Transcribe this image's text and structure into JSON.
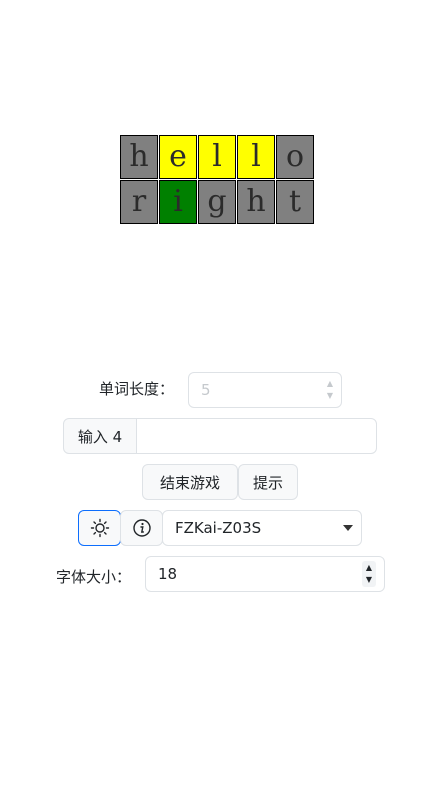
{
  "board": {
    "rows": [
      [
        {
          "letter": "h",
          "state": "gray"
        },
        {
          "letter": "e",
          "state": "yellow"
        },
        {
          "letter": "l",
          "state": "yellow"
        },
        {
          "letter": "l",
          "state": "yellow"
        },
        {
          "letter": "o",
          "state": "gray"
        }
      ],
      [
        {
          "letter": "r",
          "state": "gray"
        },
        {
          "letter": "i",
          "state": "green"
        },
        {
          "letter": "g",
          "state": "gray"
        },
        {
          "letter": "h",
          "state": "gray"
        },
        {
          "letter": "t",
          "state": "gray"
        }
      ]
    ],
    "colors": {
      "gray": "#808080",
      "yellow": "#ffff00",
      "green": "#008000"
    }
  },
  "word_length": {
    "label": "单词长度：",
    "value": "5"
  },
  "guess": {
    "button_label": "输入 4",
    "value": ""
  },
  "actions": {
    "end_game": "结束游戏",
    "hint": "提示"
  },
  "toolbar": {
    "theme_icon": "sun-icon",
    "info_icon": "info-icon",
    "font_selected": "FZKai-Z03S"
  },
  "font_size": {
    "label": "字体大小：",
    "value": "18"
  }
}
